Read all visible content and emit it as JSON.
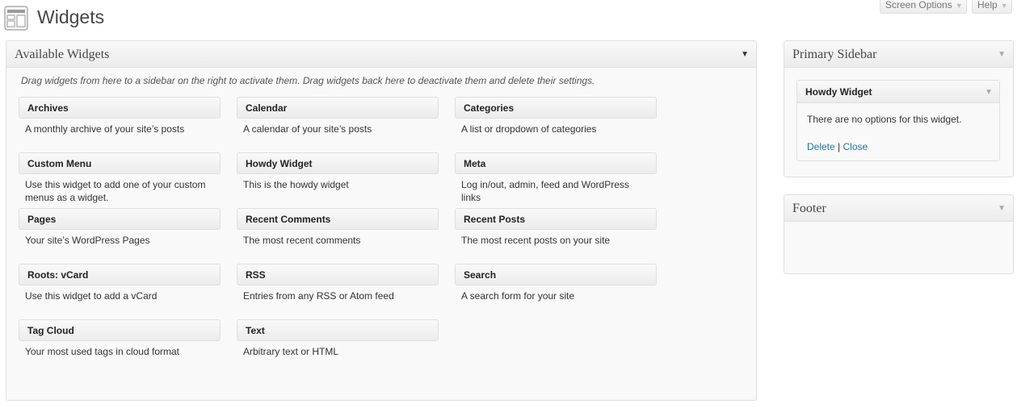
{
  "header": {
    "title": "Widgets",
    "page_icon": "widgets-icon",
    "screen_options_label": "Screen Options",
    "help_label": "Help"
  },
  "available_widgets": {
    "title": "Available Widgets",
    "description": "Drag widgets from here to a sidebar on the right to activate them. Drag widgets back here to deactivate them and delete their settings.",
    "widgets": [
      {
        "name": "Archives",
        "desc": "A monthly archive of your site’s posts"
      },
      {
        "name": "Calendar",
        "desc": "A calendar of your site’s posts"
      },
      {
        "name": "Categories",
        "desc": "A list or dropdown of categories"
      },
      {
        "name": "Custom Menu",
        "desc": "Use this widget to add one of your custom menus as a widget."
      },
      {
        "name": "Howdy Widget",
        "desc": "This is the howdy widget"
      },
      {
        "name": "Meta",
        "desc": "Log in/out, admin, feed and WordPress links"
      },
      {
        "name": "Pages",
        "desc": "Your site’s WordPress Pages"
      },
      {
        "name": "Recent Comments",
        "desc": "The most recent comments"
      },
      {
        "name": "Recent Posts",
        "desc": "The most recent posts on your site"
      },
      {
        "name": "Roots: vCard",
        "desc": "Use this widget to add a vCard"
      },
      {
        "name": "RSS",
        "desc": "Entries from any RSS or Atom feed"
      },
      {
        "name": "Search",
        "desc": "A search form for your site"
      },
      {
        "name": "Tag Cloud",
        "desc": "Your most used tags in cloud format"
      },
      {
        "name": "Text",
        "desc": "Arbitrary text or HTML"
      }
    ]
  },
  "primary_sidebar": {
    "title": "Primary Sidebar",
    "widget": {
      "name": "Howdy Widget",
      "message": "There are no options for this widget.",
      "delete_label": "Delete",
      "separator": " | ",
      "close_label": "Close"
    }
  },
  "footer": {
    "title": "Footer"
  },
  "colors": {
    "link": "#21759b",
    "border": "#dfdfdf",
    "box_bg": "#f9f9f9"
  }
}
